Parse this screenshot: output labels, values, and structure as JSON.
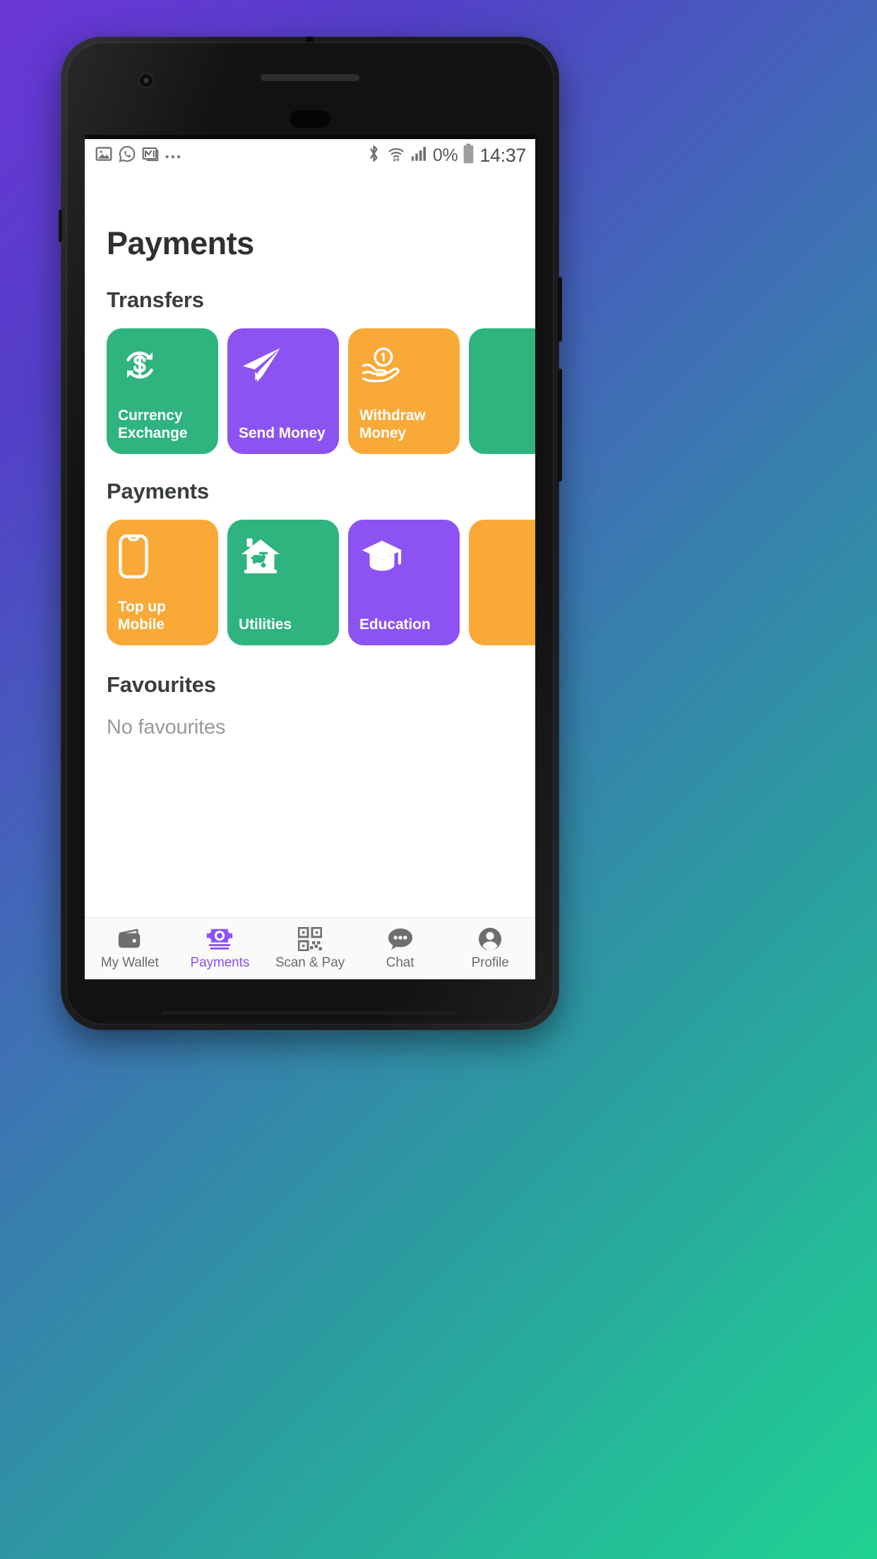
{
  "theme": {
    "green": "#2fb47f",
    "purple": "#8c53f2",
    "orange": "#f9a938",
    "accent_active": "#8a54f0",
    "title_color": "#2e3133",
    "muted_text": "#9a9a9a"
  },
  "status_bar": {
    "left_icons": [
      {
        "name": "gallery-icon"
      },
      {
        "name": "whatsapp-icon"
      },
      {
        "name": "gmail-icon"
      }
    ],
    "more_indicator": "...",
    "right_icons": [
      {
        "name": "bluetooth-icon"
      },
      {
        "name": "wifi-icon"
      },
      {
        "name": "cellular-signal-icon"
      }
    ],
    "battery_percent": "0%",
    "battery_icon": "battery-icon",
    "clock": "14:37"
  },
  "screen": {
    "title": "Payments"
  },
  "sections": [
    {
      "id": "transfers",
      "heading": "Transfers",
      "tiles": [
        {
          "label": "Currency Exchange",
          "color": "#2fb47f",
          "icon": "currency-exchange-icon"
        },
        {
          "label": "Send Money",
          "color": "#8c53f2",
          "icon": "paper-plane-icon"
        },
        {
          "label": "Withdraw Money",
          "color": "#f9a938",
          "icon": "hand-coin-icon"
        },
        {
          "label": "",
          "color": "#2fb47f",
          "icon": "partial-tile-icon"
        }
      ]
    },
    {
      "id": "payments",
      "heading": "Payments",
      "tiles": [
        {
          "label": "Top up Mobile",
          "color": "#f9a938",
          "icon": "smartphone-icon"
        },
        {
          "label": "Utilities",
          "color": "#2fb47f",
          "icon": "house-faucet-icon"
        },
        {
          "label": "Education",
          "color": "#8c53f2",
          "icon": "graduation-cap-icon"
        },
        {
          "label": "",
          "color": "#f9a938",
          "icon": "partial-tile-icon"
        }
      ]
    }
  ],
  "favourites": {
    "heading": "Favourites",
    "empty_text": "No favourites"
  },
  "bottom_nav": {
    "items": [
      {
        "label": "My Wallet",
        "icon": "wallet-icon",
        "active": false
      },
      {
        "label": "Payments",
        "icon": "banknote-icon",
        "active": true
      },
      {
        "label": "Scan & Pay",
        "icon": "qr-code-icon",
        "active": false
      },
      {
        "label": "Chat",
        "icon": "chat-bubble-icon",
        "active": false
      },
      {
        "label": "Profile",
        "icon": "person-icon",
        "active": false
      }
    ]
  }
}
